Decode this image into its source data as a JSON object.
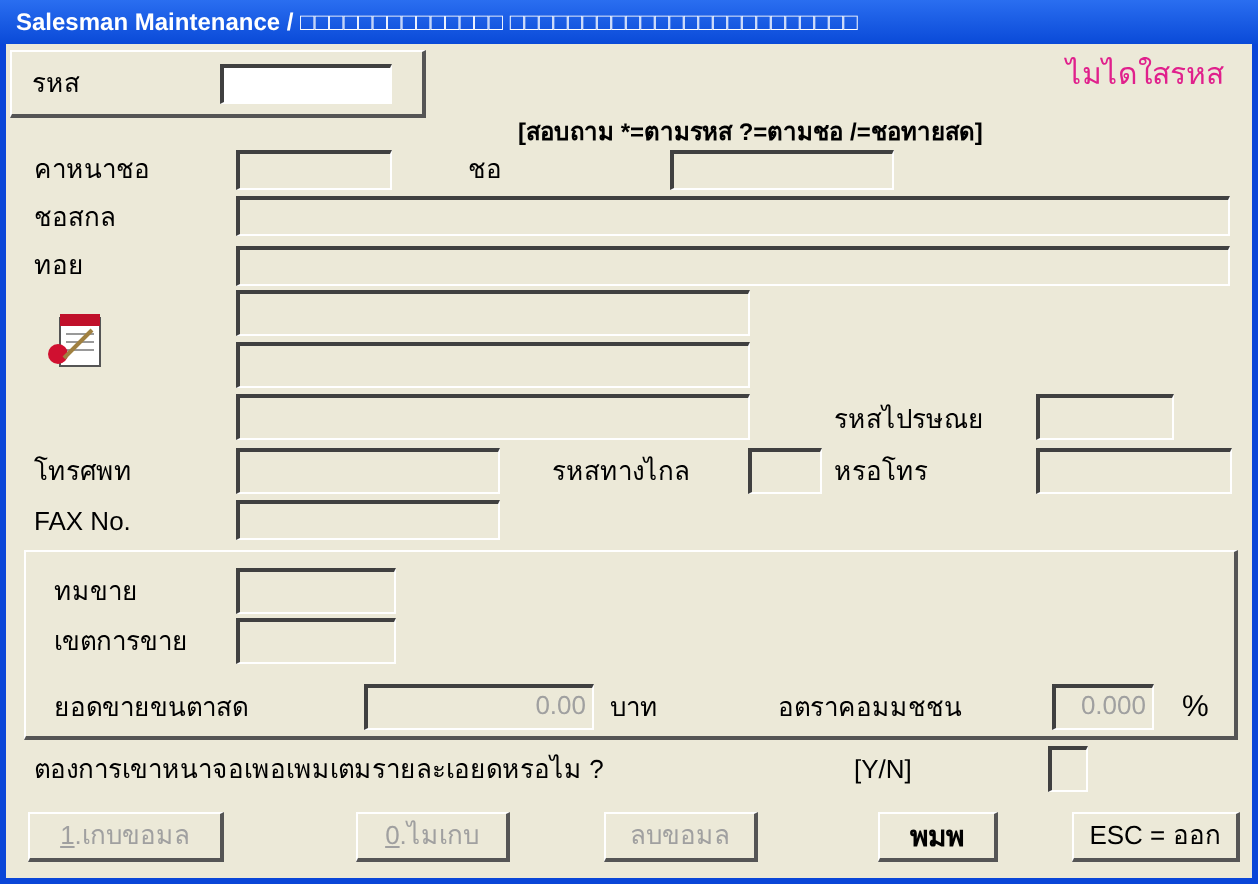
{
  "window": {
    "title": "Salesman Maintenance / □□□□□□□□□□□□□□ □□□□□□□□□□□□□□□□□□□□□□□□"
  },
  "code": {
    "label": "รหส"
  },
  "status": "ไมไดใสรหส",
  "search_hint": "[สอบถาม *=ตามรหส  ?=ตามชอ  /=ชอทายสด]",
  "prefix": {
    "label": "คาหนาชอ"
  },
  "first_name": {
    "label": "ชอ"
  },
  "last_name": {
    "label": "ชอสกล"
  },
  "address": {
    "label": "ทอย"
  },
  "postal_code": {
    "label": "รหสไปรษณย"
  },
  "phone": {
    "label": "โทรศพท"
  },
  "area_code": {
    "label": "รหสทางไกล"
  },
  "extension": {
    "label": "หรอโทร"
  },
  "fax": {
    "label": "FAX No."
  },
  "sales": {
    "team": {
      "label": "ทมขาย"
    },
    "region": {
      "label": "เขตการขาย"
    },
    "minimum": {
      "label": "ยอดขายขนตาสด",
      "value": "0.00",
      "unit": "บาท"
    },
    "commission": {
      "label": "อตราคอมมชชน",
      "value": "0.000",
      "unit": "%"
    }
  },
  "question": {
    "text": "ตองการเขาหนาจอเพอเพมเตมรายละเอยดหรอไม ?",
    "hint": "[Y/N]"
  },
  "buttons": [
    {
      "key": "1",
      "label": ".เกบขอมล",
      "disabled": true,
      "default": false
    },
    {
      "key": "0",
      "label": ".ไมเกบ",
      "disabled": true,
      "default": false
    },
    {
      "label": "ลบขอมล",
      "disabled": true,
      "default": false
    },
    {
      "label": "พมพ",
      "disabled": false,
      "default": true
    },
    {
      "label": "ESC = ออก",
      "disabled": false,
      "default": false
    }
  ]
}
